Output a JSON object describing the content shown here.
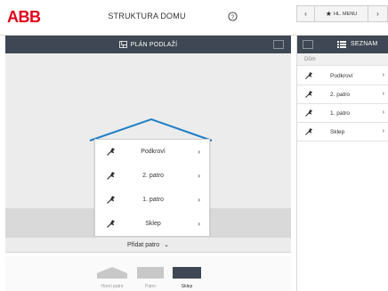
{
  "header": {
    "logo_text": "ABB",
    "title": "STRUKTURA DOMU",
    "nav_prev_icon": "chevron-left",
    "nav_next_icon": "chevron-right",
    "main_menu_label": "HL. MENU",
    "main_menu_icon": "star-icon"
  },
  "floor_plan": {
    "header_label": "PLÁN PODLAŽÍ",
    "floors": [
      {
        "label": "Podkroví"
      },
      {
        "label": "2. patro"
      },
      {
        "label": "1. patro"
      },
      {
        "label": "Sklep"
      }
    ],
    "add_floor_label": "Přidat patro",
    "thumbnails": [
      {
        "label": "Horní patro"
      },
      {
        "label": "Patro"
      },
      {
        "label": "Sklep",
        "active": true
      }
    ],
    "accent_color": "#1f7fc6"
  },
  "list_panel": {
    "header_label": "SEZNAM",
    "breadcrumb": "Dům",
    "items": [
      {
        "label": "Podkroví"
      },
      {
        "label": "2. patro"
      },
      {
        "label": "1. patro"
      },
      {
        "label": "Sklep"
      }
    ]
  },
  "colors": {
    "header_bg": "#3e4753",
    "brand_red": "#e2001a",
    "roof_blue": "#1f7fc6"
  }
}
